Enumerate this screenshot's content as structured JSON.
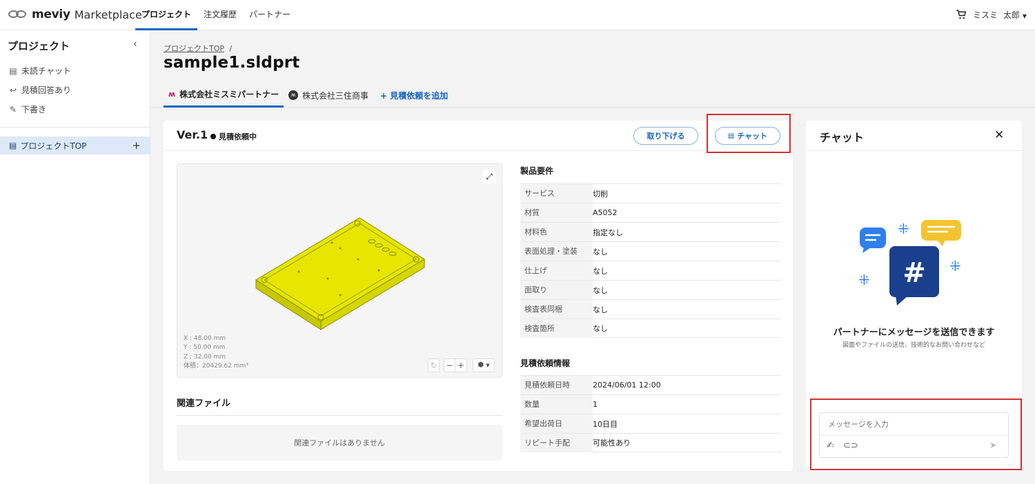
{
  "app": {
    "brand": "meviy",
    "product": "Marketplace"
  },
  "topnav": {
    "items": [
      "プロジェクト",
      "注文履歴",
      "パートナー"
    ]
  },
  "user": {
    "company": "ミスミ",
    "name": "太郎"
  },
  "sidebar": {
    "title": "プロジェクト",
    "links": [
      "未読チャット",
      "見積回答あり",
      "下書き"
    ],
    "active": "プロジェクトTOP"
  },
  "breadcrumb": {
    "link": "プロジェクトTOP",
    "sep": "/"
  },
  "page_title": "sample1.sldprt",
  "tabs": {
    "items": [
      "株式会社ミスミパートナー",
      "株式会社三住商事"
    ],
    "add": "+ 見積依頼を追加"
  },
  "version": {
    "label": "Ver.1",
    "status": "見積依頼中",
    "withdraw": "取り下げる",
    "chat": "チャット"
  },
  "viewer": {
    "dims": [
      "X : 48.00 mm",
      "Y : 50.00 mm",
      "Z : 32.00 mm",
      "体積：20429.62 mm³"
    ],
    "model_color": "#e8e800"
  },
  "related": {
    "title": "関連ファイル",
    "empty": "関連ファイルはありません"
  },
  "spec": {
    "title": "製品要件",
    "rows": [
      {
        "k": "サービス",
        "v": "切削"
      },
      {
        "k": "材質",
        "v": "A5052"
      },
      {
        "k": "材料色",
        "v": "指定なし"
      },
      {
        "k": "表面処理・塗装",
        "v": "なし"
      },
      {
        "k": "仕上げ",
        "v": "なし"
      },
      {
        "k": "面取り",
        "v": "なし"
      },
      {
        "k": "検査表同梱",
        "v": "なし"
      },
      {
        "k": "検査箇所",
        "v": "なし"
      }
    ]
  },
  "quote": {
    "title": "見積依頼情報",
    "rows": [
      {
        "k": "見積依頼日時",
        "v": "2024/06/01 12:00"
      },
      {
        "k": "数量",
        "v": "1"
      },
      {
        "k": "希望出荷日",
        "v": "10日目"
      },
      {
        "k": "リピート手配",
        "v": "可能性あり"
      }
    ]
  },
  "chat": {
    "title": "チャット",
    "empty_title": "パートナーにメッセージを送信できます",
    "empty_sub": "図面やファイルの送信、技術的なお問い合わせなど",
    "placeholder": "メッセージを入力"
  },
  "colors": {
    "accent": "#1565c0",
    "highlight": "#d32f2f"
  }
}
